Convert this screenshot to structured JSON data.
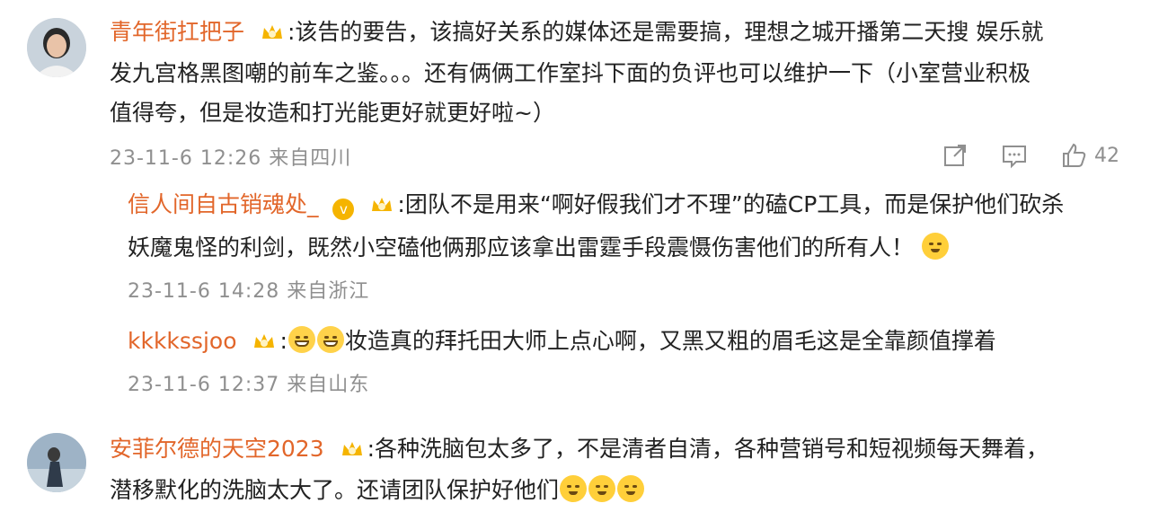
{
  "comments": [
    {
      "user": "青年街扛把子",
      "lines": [
        ":该告的要告，该搞好关系的媒体还是需要搞，理想之城开播第二天搜       娱乐就",
        "发九宫格黑图嘲的前车之鉴。。。还有俩俩工作室抖下面的负评也可以维护一下（小室营业积极",
        "值得夸，但是妆造和打光能更好就更好啦~）"
      ],
      "meta": "23-11-6 12:26 来自四川",
      "likes": "42"
    },
    {
      "user": "信人间自古销魂处_",
      "lines": [
        ":团队不是用来“啊好假我们才不理”的磕CP工具，而是保护他们砍杀",
        "妖魔鬼怪的利剑，既然小空磕他俩那应该拿出雷霆手段震慑伤害他们的所有人！"
      ],
      "meta": "23-11-6 14:28 来自浙江"
    },
    {
      "user": "kkkkssjoo",
      "lines": [
        "妆造真的拜托田大师上点心啊，又黑又粗的眉毛这是全靠颜值撑着"
      ],
      "meta": "23-11-6 12:37 来自山东"
    },
    {
      "user": "安菲尔德的天空2023",
      "lines": [
        ":各种洗脑包太多了，不是清者自清，各种营销号和短视频每天舞着，",
        "潜移默化的洗脑太大了。还请团队保护好他们"
      ]
    }
  ],
  "colors": {
    "username": "#e2662a",
    "meta": "#8f8f8f",
    "badge": "#f5b400"
  },
  "icons": [
    "share-icon",
    "comment-icon",
    "like-icon",
    "crown-badge-icon",
    "verified-badge-icon",
    "smile-emoji",
    "laugh-emoji"
  ]
}
